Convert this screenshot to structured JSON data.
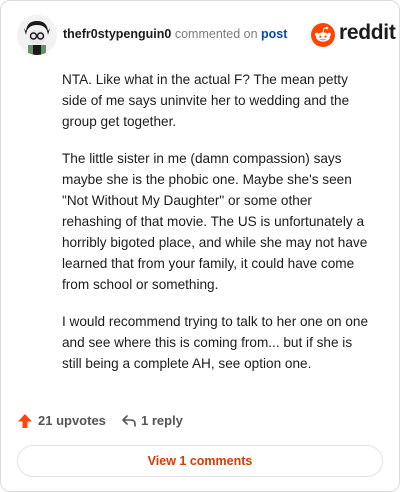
{
  "header": {
    "username": "thefr0stypenguin0",
    "commented_on": "commented on",
    "post_link": "post",
    "brand": "reddit"
  },
  "comment": {
    "paragraphs": [
      "NTA. Like what in the actual F? The mean petty side of me says uninvite her to wedding and the group get together.",
      "The little sister in me (damn compassion) says maybe she is the phobic one. Maybe she's seen \"Not Without My Daughter\" or some other rehashing of that movie. The US is unfortunately a horribly bigoted place, and while she may not have learned that from your family, it could have come from school or something.",
      "I would recommend trying to talk to her one on one and see where this is coming from... but if she is still being a complete AH, see option one."
    ]
  },
  "actions": {
    "upvotes": "21 upvotes",
    "replies": "1 reply"
  },
  "footer": {
    "view_comments": "View 1 comments"
  },
  "colors": {
    "accent": "#d93a00",
    "link": "#0a4ba8",
    "upvote": "#ff4500"
  }
}
